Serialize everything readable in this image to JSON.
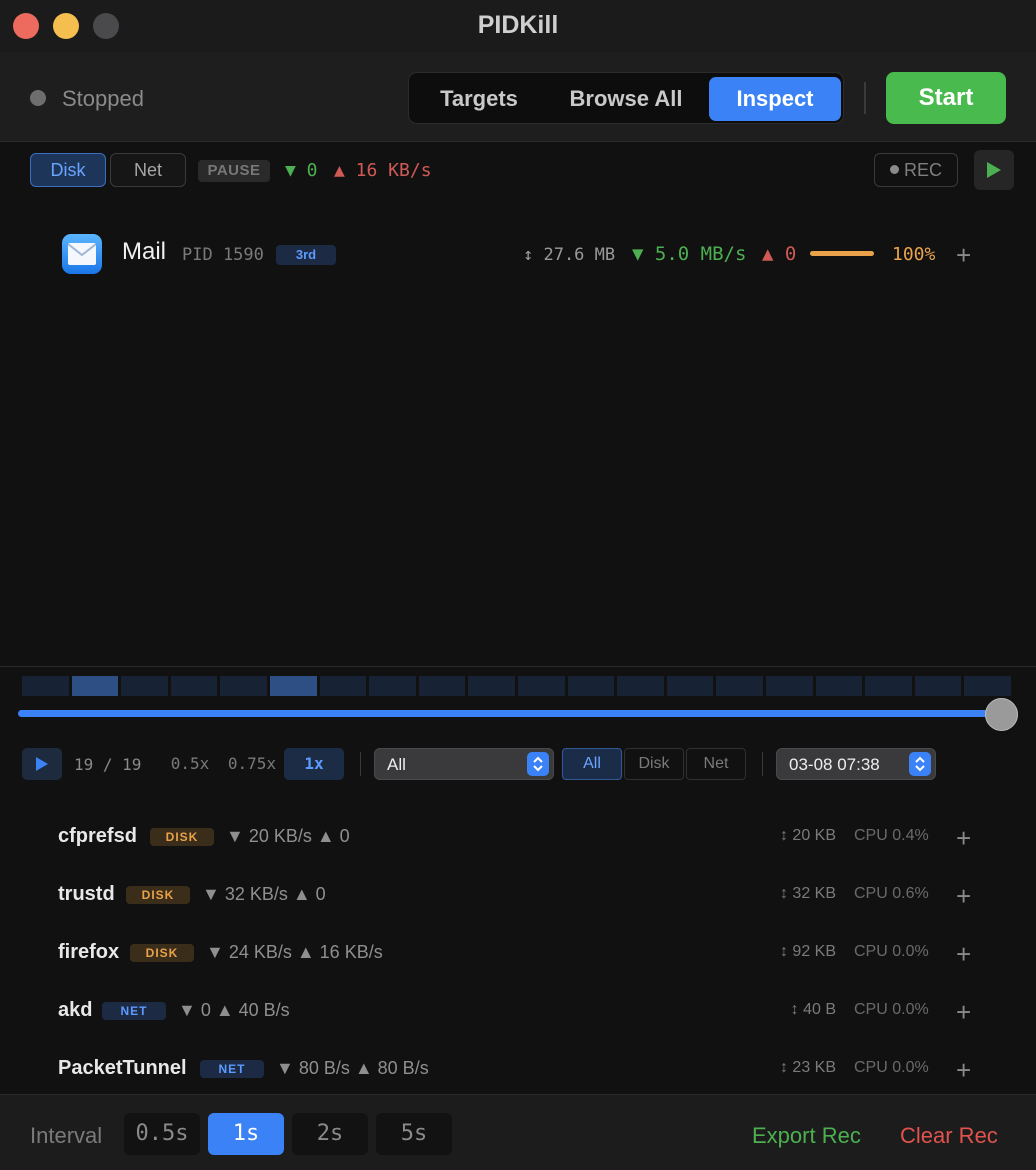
{
  "window": {
    "title": "PIDKill"
  },
  "toolbar": {
    "status": "Stopped",
    "tabs": [
      "Targets",
      "Browse All",
      "Inspect"
    ],
    "active_tab": "Inspect",
    "start_label": "Start"
  },
  "filter_bar": {
    "disk_label": "Disk",
    "net_label": "Net",
    "pause_label": "PAUSE",
    "rate_down": "▼ 0",
    "rate_up": "▲ 16 KB/s",
    "rec_label": "REC"
  },
  "focused_process": {
    "name": "Mail",
    "pid": "PID 1590",
    "rank": "3rd",
    "size": "↕ 27.6 MB",
    "down": "▼ 5.0 MB/s",
    "up": "▲ 0",
    "percent_label": "100%",
    "percent_value": 100
  },
  "timeline": {
    "segment_count": 20,
    "active_segments": [
      1,
      5
    ],
    "position_fraction": 1.0
  },
  "playback": {
    "frame": "19 / 19",
    "speeds": [
      "0.5x",
      "0.75x",
      "1x"
    ],
    "active_speed": "1x",
    "filter_select": "All",
    "type_filters": [
      "All",
      "Disk",
      "Net"
    ],
    "active_type_filter": "All",
    "date_select": "03-08 07:38"
  },
  "processes": [
    {
      "name": "cfprefsd",
      "badge": "DISK",
      "rates": "▼ 20 KB/s  ▲ 0",
      "size": "↕ 20 KB",
      "cpu": "CPU 0.4%"
    },
    {
      "name": "trustd",
      "badge": "DISK",
      "rates": "▼ 32 KB/s  ▲ 0",
      "size": "↕ 32 KB",
      "cpu": "CPU 0.6%"
    },
    {
      "name": "firefox",
      "badge": "DISK",
      "rates": "▼ 24 KB/s  ▲ 16 KB/s",
      "size": "↕ 92 KB",
      "cpu": "CPU 0.0%"
    },
    {
      "name": "akd",
      "badge": "NET",
      "rates": "▼ 0  ▲ 40 B/s",
      "size": "↕ 40 B",
      "cpu": "CPU 0.0%"
    },
    {
      "name": "PacketTunnel",
      "badge": "NET",
      "rates": "▼ 80 B/s  ▲ 80 B/s",
      "size": "↕ 23 KB",
      "cpu": "CPU 0.0%"
    }
  ],
  "footer": {
    "interval_label": "Interval",
    "intervals": [
      "0.5s",
      "1s",
      "2s",
      "5s"
    ],
    "active_interval": "1s",
    "export_label": "Export Rec",
    "clear_label": "Clear Rec"
  },
  "colors": {
    "accent": "#3b82f6",
    "start_green": "#49bb4e",
    "down_green": "#4caf50",
    "up_red": "#d05a55",
    "disk_orange": "#e9a24a",
    "clear_red": "#e0534d"
  }
}
